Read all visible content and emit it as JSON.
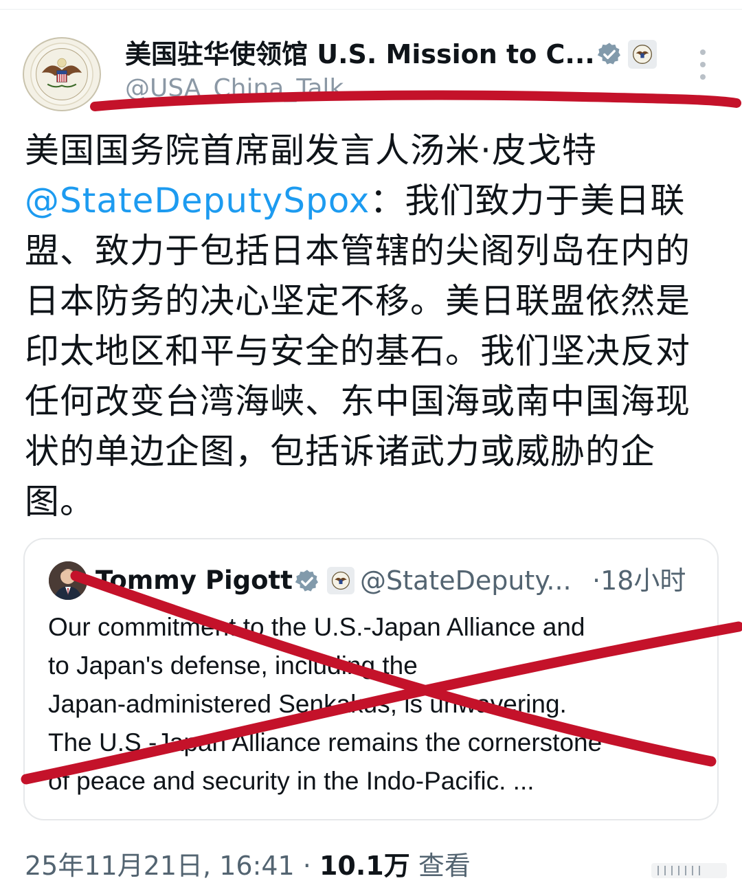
{
  "header": {
    "author_name": "美国驻华使领馆 U.S. Mission to C...",
    "author_handle": "@USA_China_Talk"
  },
  "tweet": {
    "line1": "美国国务院首席副发言人汤米·皮戈特",
    "mention": "@StateDeputySpox",
    "line2_rest": "：我们致力于美日联",
    "line3": "盟、致力于包括日本管辖的尖阁列岛在内的",
    "line4": "日本防务的决心坚定不移。美日联盟依然是",
    "line5": "印太地区和平与安全的基石。我们坚决反对",
    "line6": "任何改变台湾海峡、东中国海或南中国海现",
    "line7": "状的单边企图，包括诉诸武力或威胁的企",
    "line8": "图。"
  },
  "quote": {
    "name": "Tommy Pigott",
    "handle": "@StateDeputy...",
    "time": "·18小时",
    "lines": [
      "Our commitment to the U.S.-Japan Alliance and",
      "to Japan's defense, including the",
      "Japan-administered Senkakus, is unwavering.",
      "The U.S.-Japan Alliance remains the cornerstone",
      "of peace and security in the Indo-Pacific.  ..."
    ]
  },
  "footer": {
    "timestamp": "25年11月21日, 16:41 · ",
    "views_count": "10.1万",
    "views_label": " 查看"
  },
  "colors": {
    "accent": "#1d9bf0",
    "verified": "#829aab",
    "marker_red": "#c4122a"
  },
  "icons": [
    "verified-icon",
    "state-seal-icon",
    "more-icon",
    "bookmark-icon"
  ]
}
